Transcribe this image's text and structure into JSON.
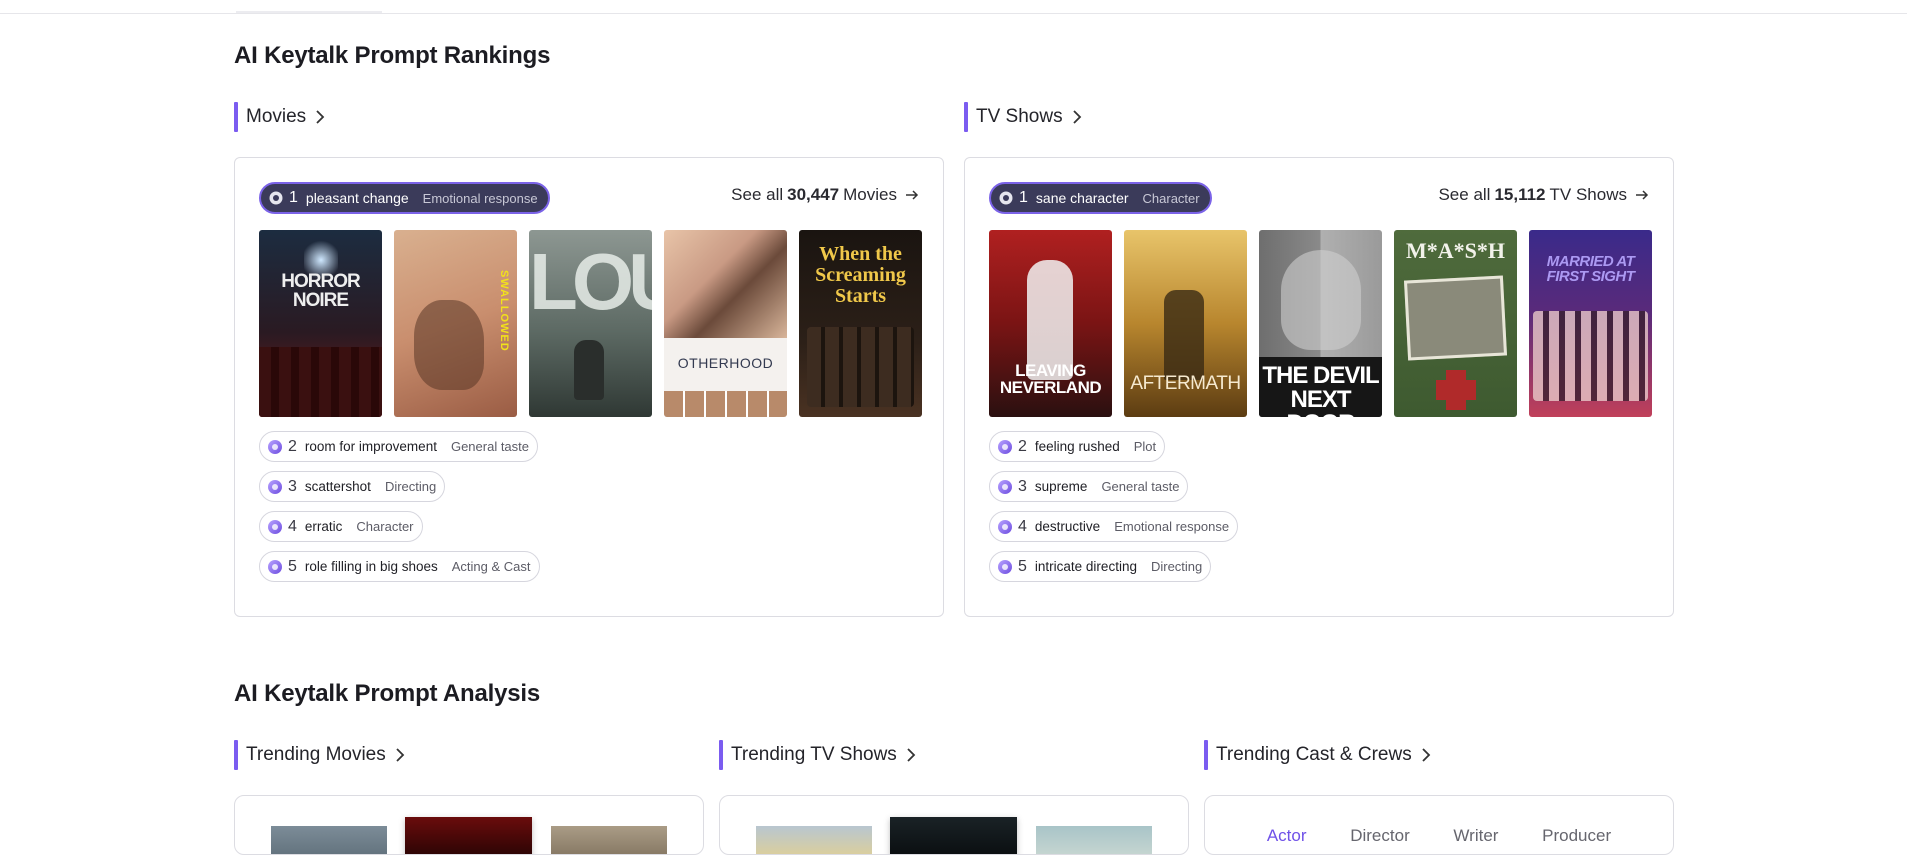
{
  "rankings": {
    "title": "AI Keytalk Prompt Rankings",
    "movies": {
      "heading": "Movies",
      "see_all_prefix": "See all",
      "see_all_count": "30,447",
      "see_all_suffix": "Movies",
      "top": {
        "rank": "1",
        "keyword": "pleasant change",
        "category": "Emotional response"
      },
      "posters": [
        "HORROR NOIRE",
        "SWALLOWED",
        "LOU",
        "OTHERHOOD",
        "When the Screaming Starts"
      ],
      "others": [
        {
          "rank": "2",
          "keyword": "room for improvement",
          "category": "General taste"
        },
        {
          "rank": "3",
          "keyword": "scattershot",
          "category": "Directing"
        },
        {
          "rank": "4",
          "keyword": "erratic",
          "category": "Character"
        },
        {
          "rank": "5",
          "keyword": "role filling in big shoes",
          "category": "Acting & Cast"
        }
      ]
    },
    "tv": {
      "heading": "TV Shows",
      "see_all_prefix": "See all",
      "see_all_count": "15,112",
      "see_all_suffix": "TV Shows",
      "top": {
        "rank": "1",
        "keyword": "sane character",
        "category": "Character"
      },
      "posters": [
        "LEAVING NEVERLAND",
        "AFTERMATH",
        "THE DEVIL NEXT DOOR",
        "M*A*S*H",
        "MARRIED AT FIRST SIGHT"
      ],
      "others": [
        {
          "rank": "2",
          "keyword": "feeling rushed",
          "category": "Plot"
        },
        {
          "rank": "3",
          "keyword": "supreme",
          "category": "General taste"
        },
        {
          "rank": "4",
          "keyword": "destructive",
          "category": "Emotional response"
        },
        {
          "rank": "5",
          "keyword": "intricate directing",
          "category": "Directing"
        }
      ]
    }
  },
  "analysis": {
    "title": "AI Keytalk Prompt Analysis",
    "trending_movies": "Trending Movies",
    "trending_tv": "Trending TV Shows",
    "trending_cast": "Trending Cast & Crews",
    "cast_tabs": [
      "Actor",
      "Director",
      "Writer",
      "Producer"
    ]
  },
  "colors": {
    "accent": "#7b5cf0",
    "badge_bg": "#3b3b5a",
    "active_tab": "#6f51e8"
  },
  "icons": {
    "chevron": "chevron-right-icon",
    "arrow": "arrow-right-icon",
    "eye": "eye-icon",
    "keyword_dot": "keytalk-dot-icon"
  }
}
